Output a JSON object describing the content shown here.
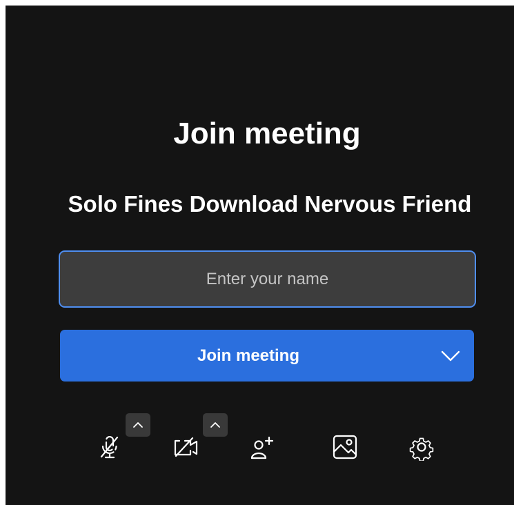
{
  "join": {
    "title": "Join meeting",
    "meeting_name": "Solo Fines Download Nervous Friend",
    "name_input": {
      "placeholder": "Enter your name",
      "value": ""
    },
    "join_button_label": "Join meeting"
  },
  "toolbar": {
    "items": [
      {
        "name": "microphone-muted",
        "icon": "mic-off-icon",
        "has_options_caret": true
      },
      {
        "name": "camera-off",
        "icon": "camera-off-icon",
        "has_options_caret": true
      },
      {
        "name": "invite-people",
        "icon": "add-person-icon",
        "has_options_caret": false
      },
      {
        "name": "background",
        "icon": "image-icon",
        "has_options_caret": false
      },
      {
        "name": "settings",
        "icon": "gear-icon",
        "has_options_caret": false
      }
    ]
  },
  "colors": {
    "background": "#141414",
    "input_background": "#3d3d3d",
    "input_border": "#4f8ef0",
    "primary_button": "#2b6fde",
    "text": "#ffffff"
  }
}
